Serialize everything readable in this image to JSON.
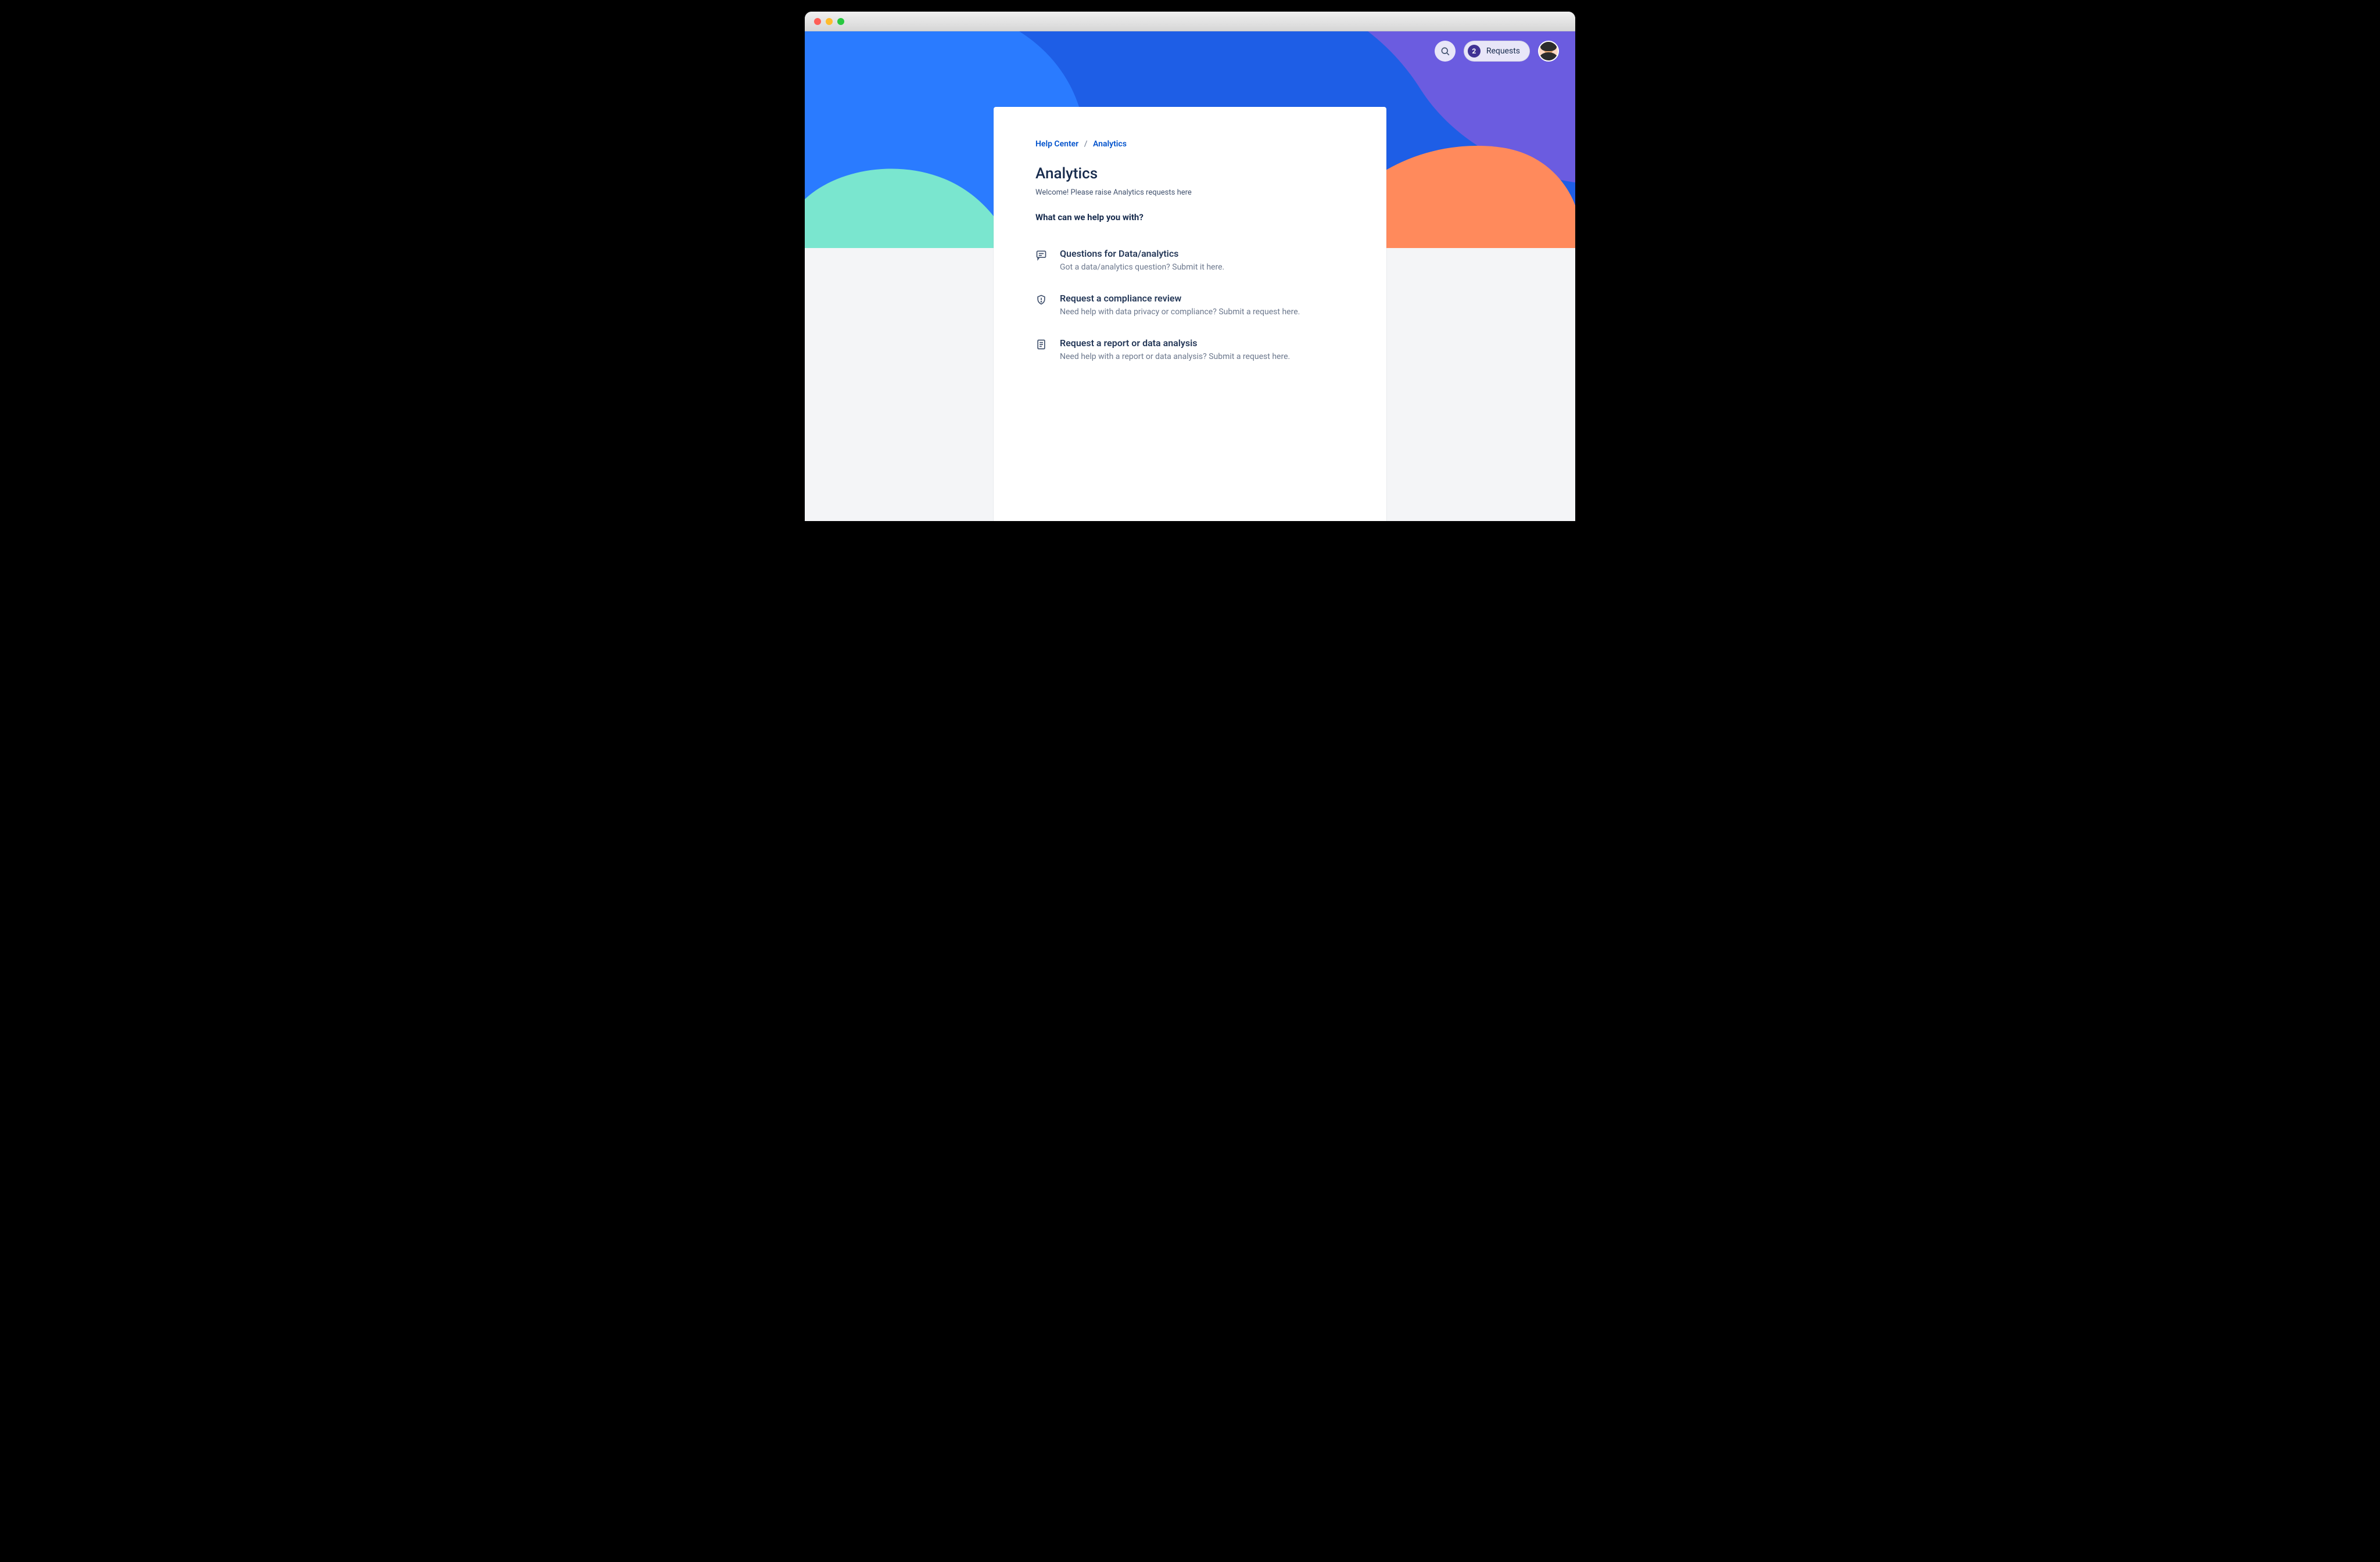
{
  "topbar": {
    "requests_count": "2",
    "requests_label": "Requests"
  },
  "breadcrumb": {
    "root": "Help Center",
    "current": "Analytics"
  },
  "page": {
    "title": "Analytics",
    "welcome": "Welcome! Please raise Analytics requests here",
    "help_heading": "What can we help you with?"
  },
  "requests": [
    {
      "icon": "chat",
      "title": "Questions for Data/analytics",
      "desc": "Got a data/analytics question? Submit it here."
    },
    {
      "icon": "shield",
      "title": "Request a compliance review",
      "desc": "Need help with data privacy or compliance? Submit a request here."
    },
    {
      "icon": "report",
      "title": "Request a report or data analysis",
      "desc": "Need help with a report or data analysis? Submit a request here."
    }
  ]
}
